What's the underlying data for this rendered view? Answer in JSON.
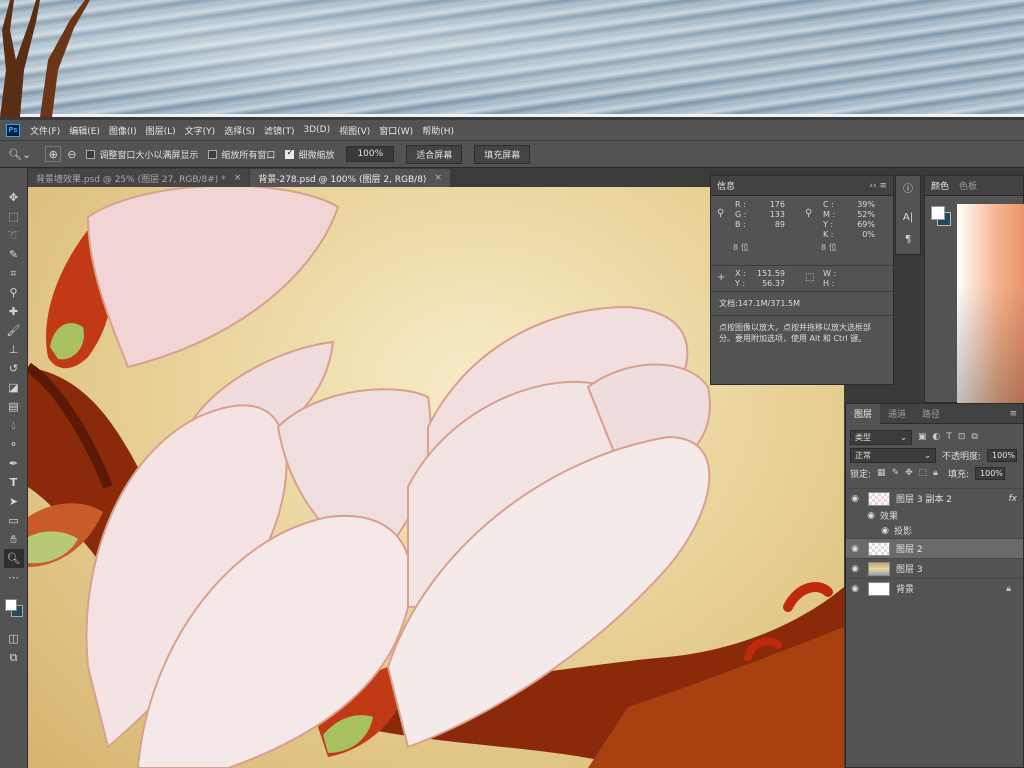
{
  "menubar": {
    "logo": "Ps",
    "items": [
      "文件(F)",
      "编辑(E)",
      "图像(I)",
      "图层(L)",
      "文字(Y)",
      "选择(S)",
      "滤镜(T)",
      "3D(D)",
      "视图(V)",
      "窗口(W)",
      "帮助(H)"
    ]
  },
  "options": {
    "resize_windows": "调整窗口大小以满屏显示",
    "zoom_all": "缩放所有窗口",
    "scrubby_zoom": "细微缩放",
    "zoom_value": "100%",
    "fit_screen": "适合屏幕",
    "fill_screen": "填充屏幕"
  },
  "tabs": [
    {
      "label": "背景墙效果.psd @ 25% (图层 27, RGB/8#) *"
    },
    {
      "label": "背景-278.psd @ 100% (图层 2, RGB/8)"
    }
  ],
  "info_panel": {
    "title": "信息",
    "rgb": {
      "r_label": "R :",
      "r": "176",
      "g_label": "G :",
      "g": "133",
      "b_label": "B :",
      "b": "89",
      "bits": "8 位"
    },
    "cmyk": {
      "c_label": "C :",
      "c": "39%",
      "m_label": "M :",
      "m": "52%",
      "y_label": "Y :",
      "y": "69%",
      "k_label": "K :",
      "k": "0%",
      "bits": "8 位"
    },
    "pos": {
      "x_label": "X :",
      "x": "151.59",
      "y_label": "Y :",
      "y": "56.37",
      "w_label": "W :",
      "h_label": "H :"
    },
    "doc": "文档:147.1M/371.5M",
    "hint": "点按图像以放大，点按并拖移以放大选框部分。要用附加选项，使用 Alt 和 Ctrl 键。"
  },
  "color_panel": {
    "tab1": "颜色",
    "tab2": "色板"
  },
  "layers_panel": {
    "tabs": [
      "图层",
      "通道",
      "路径"
    ],
    "filter_label": "类型",
    "blend_mode": "正常",
    "opacity_label": "不透明度:",
    "opacity": "100%",
    "lock_label": "锁定:",
    "fill_label": "填充:",
    "fill": "100%",
    "layers": [
      {
        "name": "图层 3 副本 2",
        "fx": "fx"
      },
      {
        "effects_label": "效果",
        "drop_shadow": "投影"
      },
      {
        "name": "图层 2"
      },
      {
        "name": "图层 3"
      },
      {
        "name": "背景"
      }
    ]
  }
}
